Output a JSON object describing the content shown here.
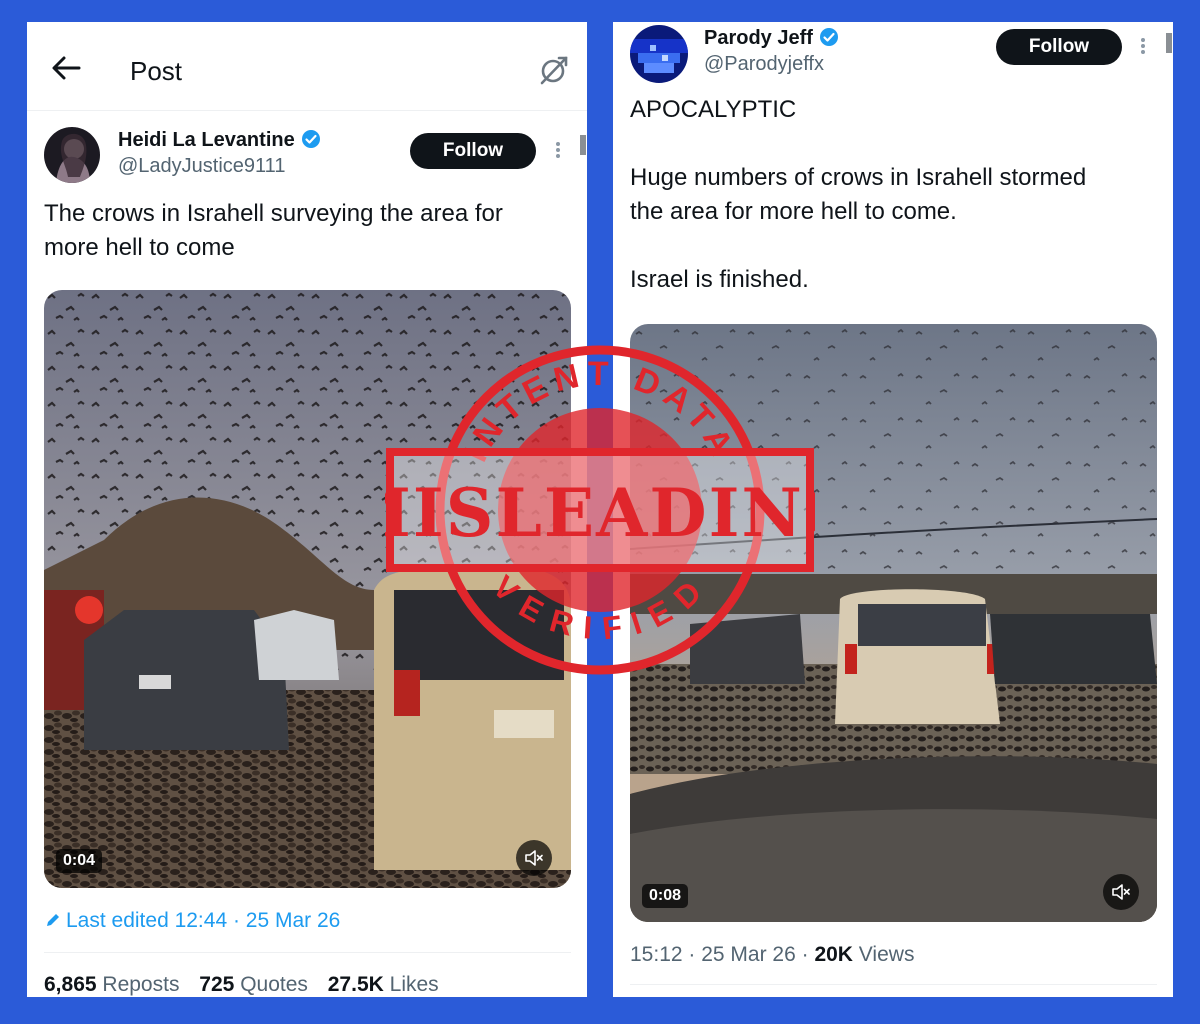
{
  "left_post": {
    "header": {
      "title": "Post",
      "back_icon": "arrow-left-icon",
      "sync_icon": "sync-off-icon"
    },
    "author": {
      "name": "Heidi La Levantine",
      "handle": "@LadyJustice9111",
      "verified": true
    },
    "follow_label": "Follow",
    "text": "The crows in Israhell surveying the area for\nmore hell to come",
    "video": {
      "duration": "0:04",
      "muted": true
    },
    "edited": "Last edited 12:44 · 25 Mar 26",
    "stats": [
      {
        "value": "6,865",
        "label": "Reposts"
      },
      {
        "value": "725",
        "label": "Quotes"
      },
      {
        "value": "27.5K",
        "label": "Likes"
      }
    ]
  },
  "right_post": {
    "author": {
      "name": "Parody Jeff",
      "handle": "@Parodyjeffx",
      "verified": true
    },
    "follow_label": "Follow",
    "text": "APOCALYPTIC\n\nHuge numbers of crows in Israhell stormed\nthe area for more hell to come.\n\nIsrael is finished.",
    "video": {
      "duration": "0:08",
      "muted": true
    },
    "meta": {
      "time": "15:12 · 25 Mar 26 · ",
      "views_value": "20K",
      "views_label": " Views"
    }
  },
  "stamp": {
    "main_word": "MISLEADING",
    "top_arc": "INTENT DATA",
    "bottom_arc": "VERIFIED",
    "color": "#e0262c"
  },
  "colors": {
    "background": "#2b5bd8",
    "link": "#1d9bf0",
    "verified": "#1d9bf0",
    "button": "#0f1419"
  }
}
